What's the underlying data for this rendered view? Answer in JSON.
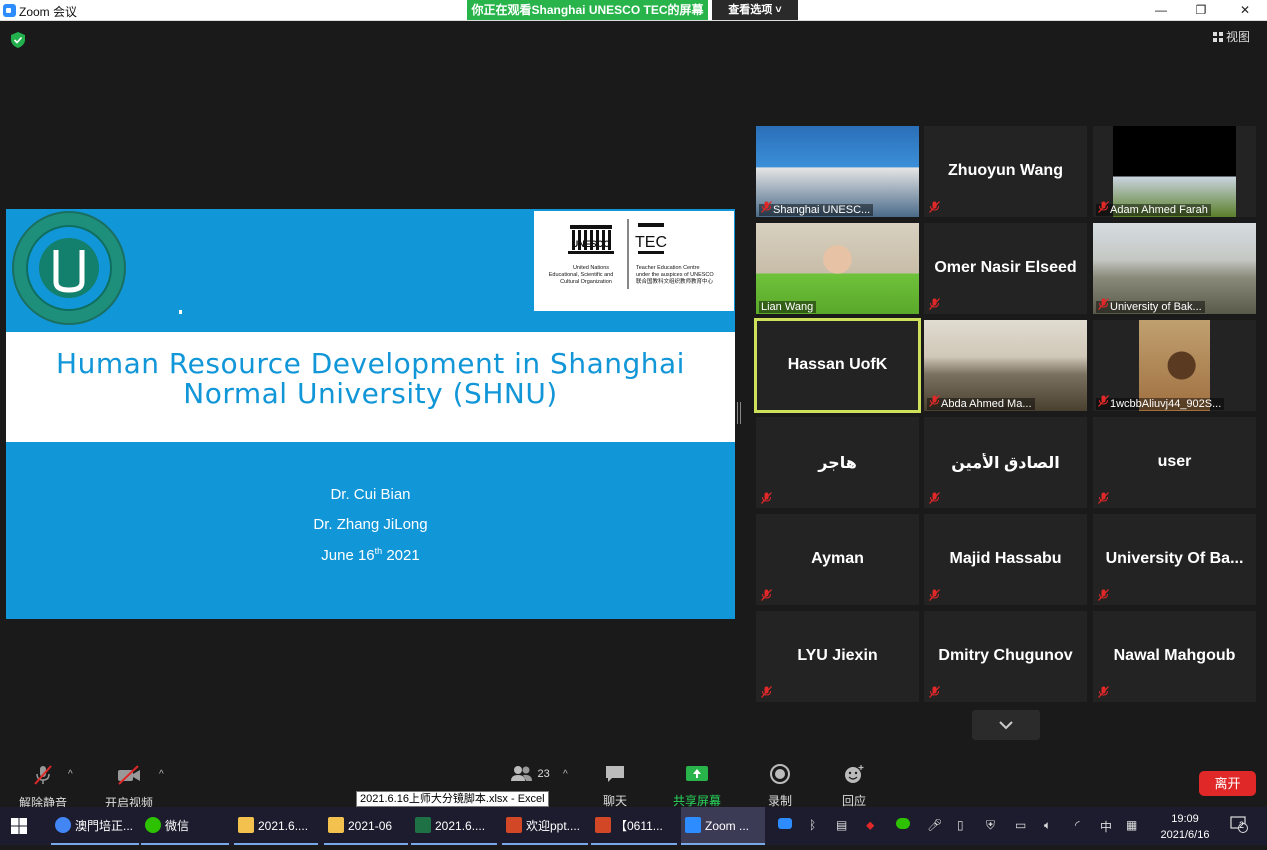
{
  "window": {
    "title": "Zoom 会议",
    "minimize": "—",
    "maximize": "❐",
    "close": "✕"
  },
  "share_banner": "你正在观看Shanghai UNESCO TEC的屏幕",
  "view_options": "查看选项 ˅",
  "view_button": "视图",
  "slide": {
    "title_line1": "Human Resource Development in Shanghai",
    "title_line2": "Normal University (SHNU)",
    "author1": "Dr. Cui Bian",
    "author2": "Dr. Zhang JiLong",
    "date_pre": "June 16",
    "date_sup": "th",
    "date_post": " 2021",
    "unesco_text": "UNESCO",
    "unesco_sub": "United Nations\nEducational, Scientific and\nCultural Organization",
    "tec_text": "TEC",
    "tec_sub": "Teacher Education Centre\nunder the auspices of UNESCO\n联合国教科文组织教师教育中心"
  },
  "participants": [
    {
      "label": "Shanghai UNESC...",
      "video": true
    },
    {
      "name": "Zhuoyun Wang"
    },
    {
      "label": "Adam Ahmed Farah",
      "video": true
    },
    {
      "label": "Lian Wang",
      "video": true
    },
    {
      "name": "Omer Nasir Elseed"
    },
    {
      "label": "University of Bak...",
      "video": true
    },
    {
      "name": "Hassan UofK",
      "active": true
    },
    {
      "label": "Abda Ahmed Ma...",
      "video": true
    },
    {
      "label": "1wcbbAliuvj44_902S...",
      "video": true
    },
    {
      "name": "هاجر"
    },
    {
      "name": "الصادق الأمين"
    },
    {
      "name": "user"
    },
    {
      "name": "Ayman"
    },
    {
      "name": "Majid Hassabu"
    },
    {
      "name": "University Of Ba..."
    },
    {
      "name": "LYU Jiexin"
    },
    {
      "name": "Dmitry Chugunov"
    },
    {
      "name": "Nawal Mahgoub"
    }
  ],
  "toolbar": {
    "unmute": "解除静音",
    "start_video": "开启视频",
    "participants_count": "23",
    "chat": "聊天",
    "share_screen": "共享屏幕",
    "record": "录制",
    "reactions": "回应",
    "leave": "离开"
  },
  "tooltip": "2021.6.16上师大分镜脚本.xlsx - Excel",
  "taskbar": {
    "items": [
      "澳門培正...",
      "微信",
      "2021.6....",
      "2021-06",
      "2021.6....",
      "欢迎ppt....",
      "【0611...",
      "Zoom ..."
    ],
    "ime": "中",
    "time": "19:09",
    "date": "2021/6/16",
    "notifications": "2"
  },
  "colors": {
    "slide_blue": "#1196d8",
    "share_green": "#28b44b",
    "leave_red": "#e02828",
    "active_speaker": "#cfe05a"
  }
}
